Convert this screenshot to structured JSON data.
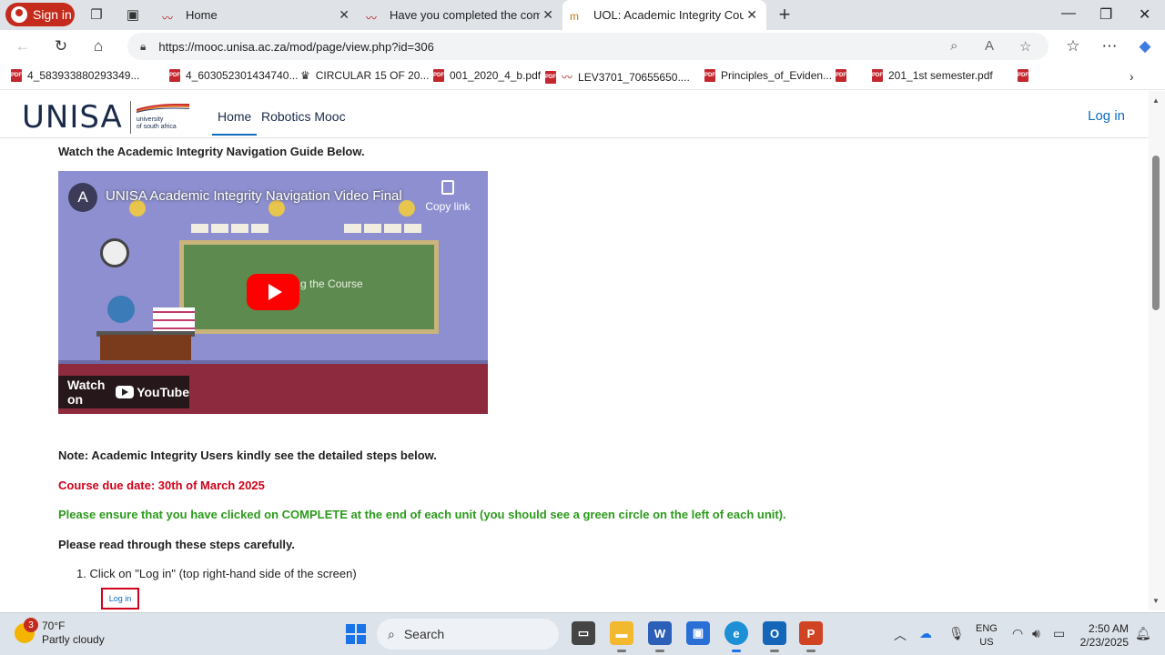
{
  "browser": {
    "signin_label": "Sign in",
    "tabs": [
      {
        "label": "Home",
        "active": false
      },
      {
        "label": "Have you completed the compuls",
        "active": false
      },
      {
        "label": "UOL: Academic Integrity Course S",
        "active": true
      }
    ],
    "new_tab_symbol": "+",
    "url": "https://mooc.unisa.ac.za/mod/page/view.php?id=306",
    "bookmarks": [
      "4_583933880293349...",
      "4_603052301434740...",
      "CIRCULAR 15 OF 20...",
      "001_2020_4_b.pdf",
      "LEV3701_70655650....",
      "Principles_of_Eviden...",
      "201_1st semester.pdf"
    ]
  },
  "site": {
    "logo_text": "UNISA",
    "logo_sub_line1": "university",
    "logo_sub_line2": "of south africa",
    "nav": [
      {
        "label": "Home",
        "active": true
      },
      {
        "label": "Robotics Mooc",
        "active": false
      }
    ],
    "login_label": "Log in"
  },
  "content": {
    "heading": "Watch the Academic Integrity Navigation Guide Below.",
    "video": {
      "channel_initial": "A",
      "title": "UNISA Academic Integrity Navigation Video Final",
      "copy_label": "Copy link",
      "board_text": "g the Course",
      "watch_label": "Watch on",
      "youtube_label": "YouTube"
    },
    "note": "Note: Academic Integrity Users kindly see the detailed steps below.",
    "due_date": "Course due date: 30th of March 2025",
    "ensure": "Please ensure that you have clicked on COMPLETE at the end of each unit (you should see a green circle on the left of each unit).",
    "read_steps": "Please read through these steps carefully.",
    "step1": "1. Click on \"Log in\" (top right-hand side of the screen)",
    "login_image_label": "Log in"
  },
  "taskbar": {
    "notification_count": "3",
    "temperature": "70°F",
    "weather": "Partly cloudy",
    "search_label": "Search",
    "lang_line1": "ENG",
    "lang_line2": "US",
    "time": "2:50 AM",
    "date": "2/23/2025"
  },
  "colors": {
    "accent": "#0f6cbf",
    "due_red": "#d0021b",
    "ensure_green": "#2c9a1c",
    "signin_red": "#c42b1c"
  }
}
